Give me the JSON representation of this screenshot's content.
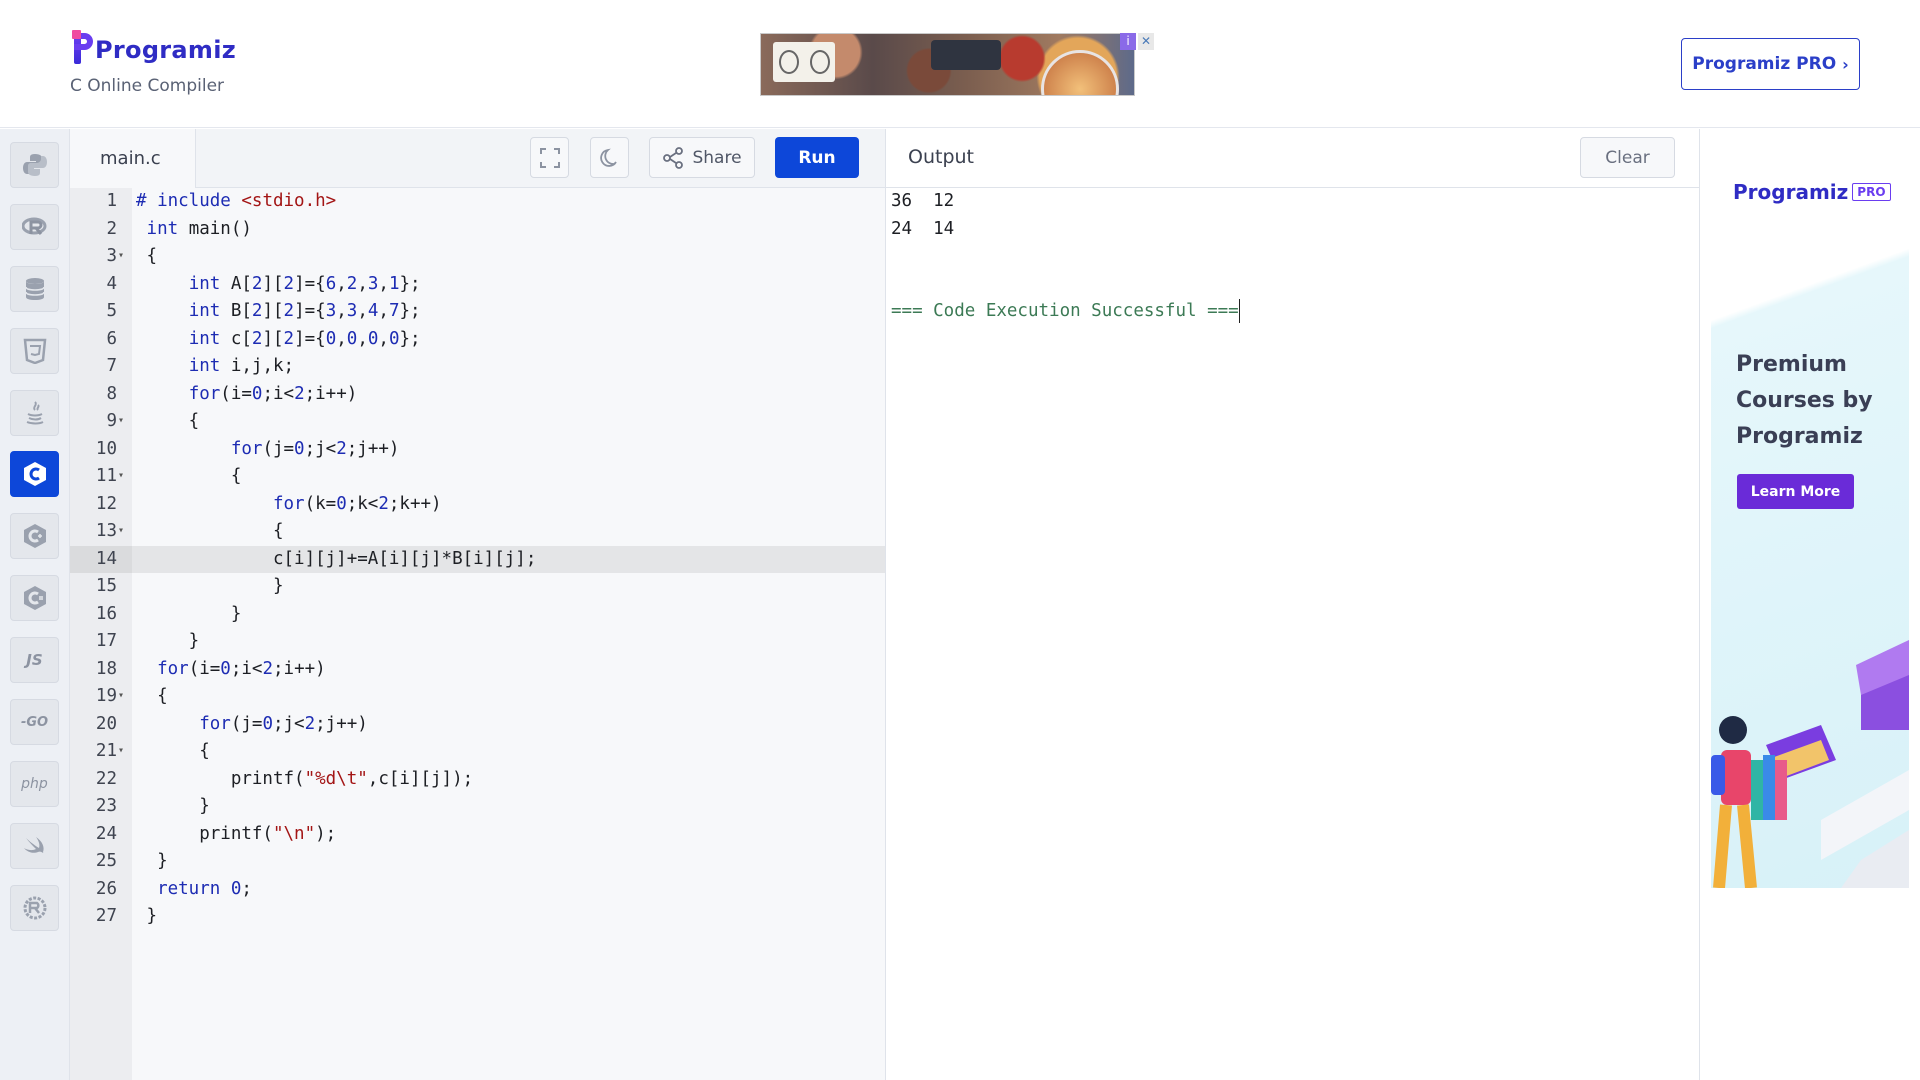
{
  "header": {
    "brand": "Programiz",
    "subtitle": "C Online Compiler",
    "pro_button": "Programiz PRO",
    "ad_info": "i",
    "ad_close": "✕"
  },
  "rail": {
    "items": [
      {
        "name": "python",
        "label": ""
      },
      {
        "name": "r",
        "label": ""
      },
      {
        "name": "sql",
        "label": ""
      },
      {
        "name": "html",
        "label": ""
      },
      {
        "name": "java",
        "label": ""
      },
      {
        "name": "c",
        "label": "",
        "active": true
      },
      {
        "name": "cpp",
        "label": ""
      },
      {
        "name": "csharp",
        "label": ""
      },
      {
        "name": "javascript",
        "label": "JS"
      },
      {
        "name": "go",
        "label": "-GO"
      },
      {
        "name": "php",
        "label": "php"
      },
      {
        "name": "swift",
        "label": ""
      },
      {
        "name": "rust",
        "label": ""
      }
    ]
  },
  "editor": {
    "file_name": "main.c",
    "share_label": "Share",
    "run_label": "Run",
    "active_line": 14,
    "lines": [
      "# include <stdio.h>",
      " int main()",
      " {",
      "     int A[2][2]={6,2,3,1};",
      "     int B[2][2]={3,3,4,7};",
      "     int c[2][2]={0,0,0,0};",
      "     int i,j,k;",
      "     for(i=0;i<2;i++)",
      "     {",
      "         for(j=0;j<2;j++)",
      "         {",
      "             for(k=0;k<2;k++)",
      "             {",
      "             c[i][j]+=A[i][j]*B[i][j];",
      "             }",
      "         }",
      "     }",
      "  for(i=0;i<2;i++)",
      "  {",
      "      for(j=0;j<2;j++)",
      "      {",
      "         printf(\"%d\\t\",c[i][j]);",
      "      }",
      "      printf(\"\\n\");",
      "  }",
      "  return 0;",
      " }"
    ],
    "fold_lines": [
      3,
      9,
      11,
      13,
      19,
      21
    ]
  },
  "output": {
    "title": "Output",
    "clear_label": "Clear",
    "lines": [
      "36  12",
      "24  14",
      "",
      "",
      "=== Code Execution Successful ==="
    ]
  },
  "side_ad": {
    "brand": "Programiz",
    "pro": "PRO",
    "headline": "Premium Courses by Programiz",
    "cta": "Learn More"
  },
  "colors": {
    "accent": "#0d47d9",
    "brand": "#2f2cc4",
    "cta_purple": "#6a2bd8"
  }
}
